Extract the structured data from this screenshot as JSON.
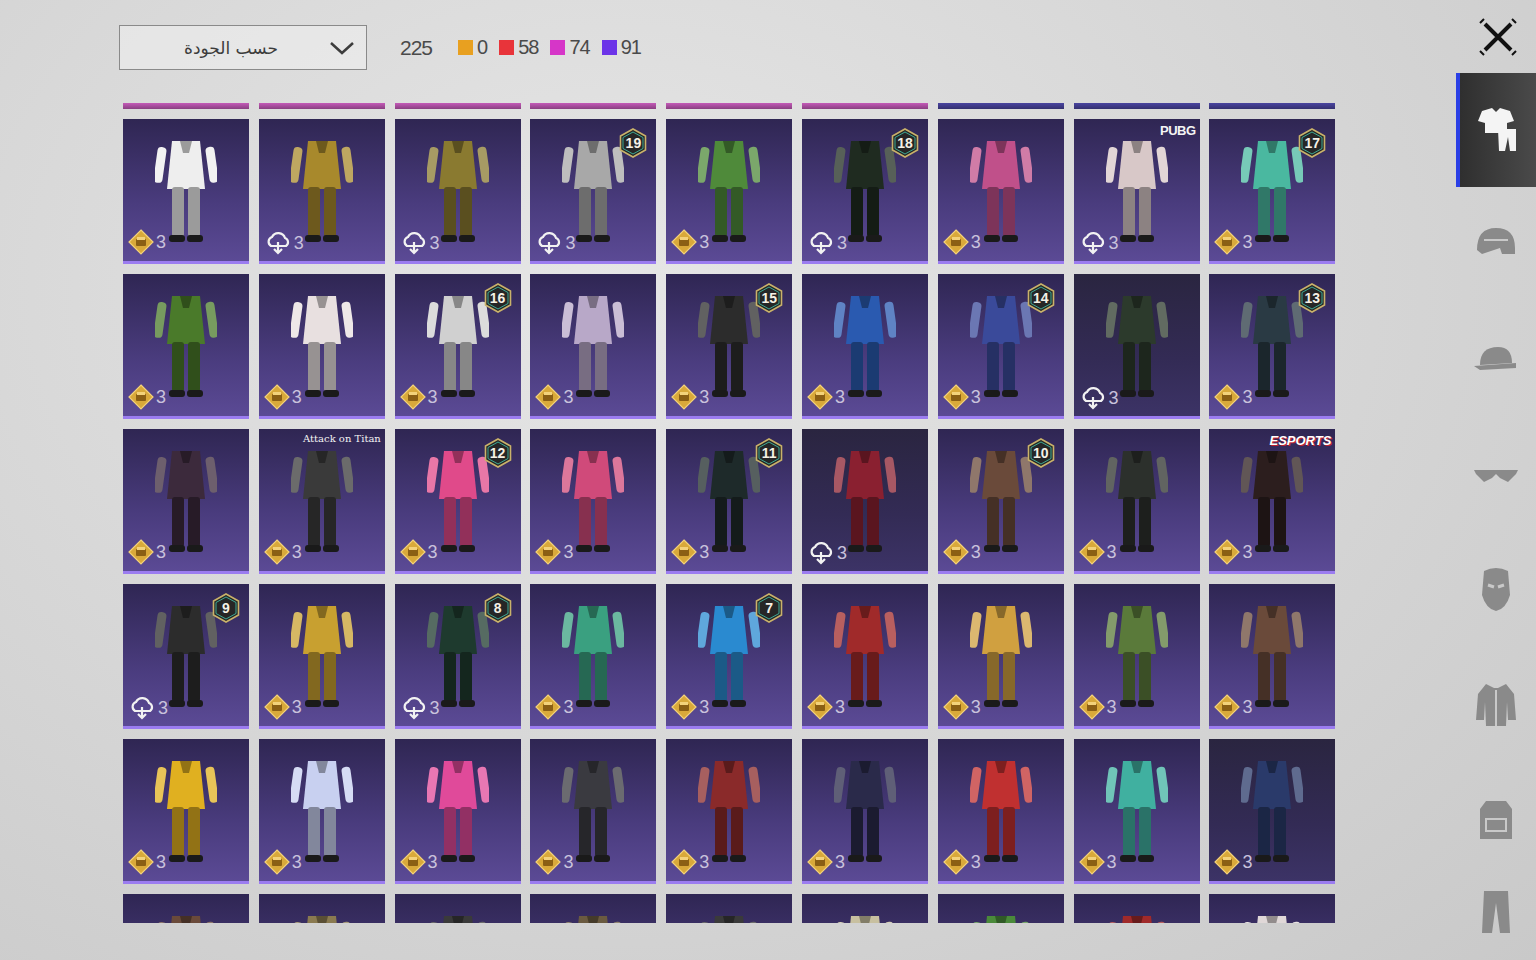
{
  "sort_dropdown": {
    "label": "حسب الجودة"
  },
  "total": "225",
  "rarities": [
    {
      "count": "0",
      "color": "#e8a020"
    },
    {
      "count": "58",
      "color": "#e8343a"
    },
    {
      "count": "74",
      "color": "#d636c8"
    },
    {
      "count": "91",
      "color": "#6c34e8"
    }
  ],
  "prev_row_edges": [
    {
      "color": "#c45ab8"
    },
    {
      "color": "#c45ab8"
    },
    {
      "color": "#c45ab8"
    },
    {
      "color": "#c45ab8"
    },
    {
      "color": "#c45ab8"
    },
    {
      "color": "#c45ab8"
    },
    {
      "color": "#4a45a0"
    },
    {
      "color": "#4a45a0"
    },
    {
      "color": "#4a45a0"
    }
  ],
  "grid": {
    "rows": [
      [
        {
          "kind": "gold",
          "count": "3",
          "color": "#eeeeee",
          "dim": false
        },
        {
          "kind": "cloud",
          "count": "3",
          "color": "#a8892c",
          "dim": false
        },
        {
          "kind": "cloud",
          "count": "3",
          "color": "#8a7a30",
          "dim": false
        },
        {
          "kind": "cloud",
          "count": "3",
          "color": "#a8a8a8",
          "dim": false,
          "badge": "19"
        },
        {
          "kind": "gold",
          "count": "3",
          "color": "#4f8a3a",
          "dim": false
        },
        {
          "kind": "cloud",
          "count": "3",
          "color": "#1f2b20",
          "dim": false,
          "badge": "18"
        },
        {
          "kind": "gold",
          "count": "3",
          "color": "#c0508a",
          "dim": false
        },
        {
          "kind": "cloud",
          "count": "3",
          "color": "#d8c8c8",
          "dim": false,
          "logo": "PUBG"
        },
        {
          "kind": "gold",
          "count": "3",
          "color": "#4ab8a0",
          "dim": false,
          "badge": "17"
        }
      ],
      [
        {
          "kind": "gold",
          "count": "3",
          "color": "#4a7a2a",
          "dim": false
        },
        {
          "kind": "gold",
          "count": "3",
          "color": "#e8e0e0",
          "dim": false
        },
        {
          "kind": "gold",
          "count": "3",
          "color": "#d0d0d0",
          "dim": false,
          "badge": "16"
        },
        {
          "kind": "gold",
          "count": "3",
          "color": "#b8a8c8",
          "dim": false
        },
        {
          "kind": "gold",
          "count": "3",
          "color": "#2c2c2c",
          "dim": false,
          "badge": "15"
        },
        {
          "kind": "gold",
          "count": "3",
          "color": "#2a5ab0",
          "dim": false
        },
        {
          "kind": "gold",
          "count": "3",
          "color": "#3a4a9a",
          "dim": false,
          "badge": "14"
        },
        {
          "kind": "cloud",
          "count": "3",
          "color": "#2c3a2c",
          "dim": true
        },
        {
          "kind": "gold",
          "count": "3",
          "color": "#2a3a44",
          "dim": false,
          "badge": "13"
        }
      ],
      [
        {
          "kind": "gold",
          "count": "3",
          "color": "#3c2a3c",
          "dim": false
        },
        {
          "kind": "gold",
          "count": "3",
          "color": "#3a3a3a",
          "dim": false,
          "logo": "Attack on Titan"
        },
        {
          "kind": "gold",
          "count": "3",
          "color": "#e04a8a",
          "dim": false,
          "badge": "12"
        },
        {
          "kind": "gold",
          "count": "3",
          "color": "#d04a7a",
          "dim": false
        },
        {
          "kind": "gold",
          "count": "3",
          "color": "#1e2a2a",
          "dim": false,
          "badge": "11"
        },
        {
          "kind": "cloud",
          "count": "3",
          "color": "#8a2030",
          "dim": true
        },
        {
          "kind": "gold",
          "count": "3",
          "color": "#6a4a3a",
          "dim": false,
          "badge": "10"
        },
        {
          "kind": "gold",
          "count": "3",
          "color": "#2c302c",
          "dim": false
        },
        {
          "kind": "gold",
          "count": "3",
          "color": "#2c1e1e",
          "dim": false,
          "logo": "ESPORTS"
        }
      ],
      [
        {
          "kind": "cloud",
          "count": "3",
          "color": "#2c2c2c",
          "dim": false,
          "badge": "9"
        },
        {
          "kind": "gold",
          "count": "3",
          "color": "#c8a030",
          "dim": false
        },
        {
          "kind": "cloud",
          "count": "3",
          "color": "#1e3a2e",
          "dim": false,
          "badge": "8"
        },
        {
          "kind": "gold",
          "count": "3",
          "color": "#3aa080",
          "dim": false
        },
        {
          "kind": "gold",
          "count": "3",
          "color": "#2a8ad0",
          "dim": false,
          "badge": "7"
        },
        {
          "kind": "gold",
          "count": "3",
          "color": "#a02a2a",
          "dim": false
        },
        {
          "kind": "gold",
          "count": "3",
          "color": "#d0a040",
          "dim": false
        },
        {
          "kind": "gold",
          "count": "3",
          "color": "#5a7a3a",
          "dim": false
        },
        {
          "kind": "gold",
          "count": "3",
          "color": "#6a4a3a",
          "dim": false
        }
      ],
      [
        {
          "kind": "gold",
          "count": "3",
          "color": "#e0b020",
          "dim": false
        },
        {
          "kind": "gold",
          "count": "3",
          "color": "#c8d0f0",
          "dim": false
        },
        {
          "kind": "gold",
          "count": "3",
          "color": "#e04a9a",
          "dim": false
        },
        {
          "kind": "gold",
          "count": "3",
          "color": "#3a3a40",
          "dim": false
        },
        {
          "kind": "gold",
          "count": "3",
          "color": "#8a2a2a",
          "dim": false
        },
        {
          "kind": "gold",
          "count": "3",
          "color": "#2a2a4a",
          "dim": false
        },
        {
          "kind": "gold",
          "count": "3",
          "color": "#c03030",
          "dim": false
        },
        {
          "kind": "gold",
          "count": "3",
          "color": "#40b0a0",
          "dim": false
        },
        {
          "kind": "gold",
          "count": "3",
          "color": "#2a3a6a",
          "dim": true
        }
      ]
    ]
  },
  "peek_row": [
    {
      "color": "#6a4a3a"
    },
    {
      "color": "#8a7a50"
    },
    {
      "color": "#3a3a3a"
    },
    {
      "color": "#6a5a40"
    },
    {
      "color": "#3a3a3a"
    },
    {
      "color": "#c8c0a0"
    },
    {
      "color": "#4a8a3a"
    },
    {
      "color": "#a02a2a"
    },
    {
      "color": "#e0d8d8"
    }
  ],
  "sidebar": {
    "tabs": [
      {
        "selected": true
      },
      {
        "selected": false
      },
      {
        "selected": false
      },
      {
        "selected": false
      },
      {
        "selected": false
      },
      {
        "selected": false
      },
      {
        "selected": false
      },
      {
        "selected": false
      }
    ]
  }
}
